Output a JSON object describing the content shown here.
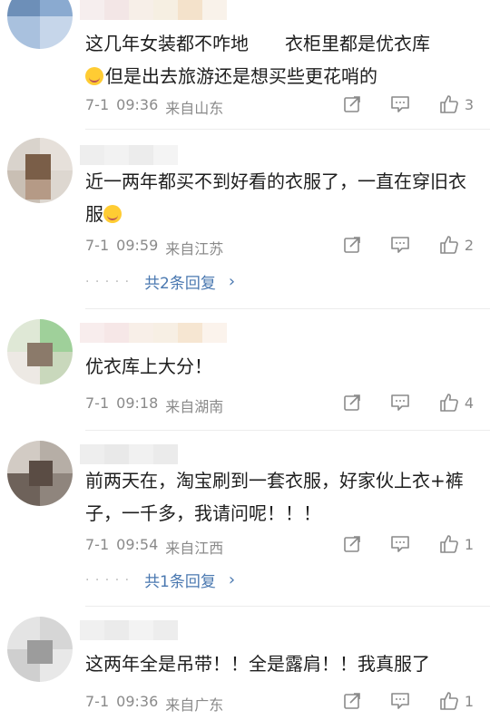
{
  "comments": [
    {
      "text_a": "这几年女装都不咋地　　衣柜里都是优衣库",
      "text_b": "但是出去旅游还是想买些更花哨的",
      "date": "7-1",
      "time": "09:36",
      "location": "来自山东",
      "likes": "3"
    },
    {
      "text_a": "近一两年都买不到好看的衣服了，一直在穿旧衣服",
      "date": "7-1",
      "time": "09:59",
      "location": "来自江苏",
      "likes": "2",
      "replies": "共2条回复"
    },
    {
      "text_a": "优衣库上大分！",
      "date": "7-1",
      "time": "09:18",
      "location": "来自湖南",
      "likes": "4"
    },
    {
      "text_a": "前两天在，淘宝刷到一套衣服，好家伙上衣+裤子，一千多，我请问呢！！！",
      "date": "7-1",
      "time": "09:54",
      "location": "来自江西",
      "likes": "1",
      "replies": "共1条回复"
    },
    {
      "text_a": "这两年全是吊带！！全是露肩！！我真服了",
      "date": "7-1",
      "time": "09:36",
      "location": "来自广东",
      "likes": "1"
    }
  ],
  "icons": {
    "share": "share-icon",
    "comment": "comment-icon",
    "like": "thumbs-up-icon",
    "more": "chevron-right-icon"
  },
  "colors": {
    "meta": "#8a8a8a",
    "link": "#4a78b0",
    "divider": "#ececec"
  }
}
